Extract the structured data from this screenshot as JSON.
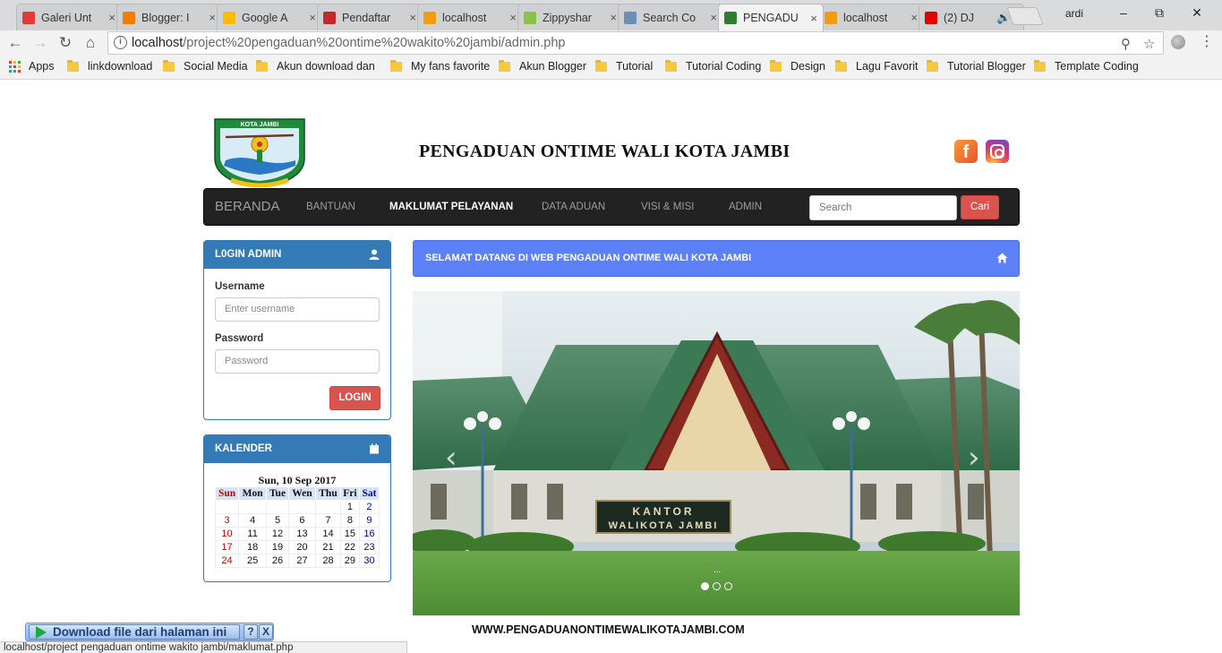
{
  "browser": {
    "tabs": [
      {
        "title": "Galeri Unt",
        "favicon_color": "#e53935"
      },
      {
        "title": "Blogger: I",
        "favicon_color": "#f57c00"
      },
      {
        "title": "Google A",
        "favicon_color": "#fbbc05"
      },
      {
        "title": "Pendaftar",
        "favicon_color": "#c62828"
      },
      {
        "title": "localhost",
        "favicon_color": "#f39c12"
      },
      {
        "title": "Zippyshar",
        "favicon_color": "#8bc34a"
      },
      {
        "title": "Search Co",
        "favicon_color": "#6d8fb5"
      },
      {
        "title": "PENGADU",
        "favicon_color": "#2e7d32"
      },
      {
        "title": "localhost",
        "favicon_color": "#f39c12"
      },
      {
        "title": "(2) DJ",
        "favicon_color": "#e00000"
      }
    ],
    "user": "ardi",
    "url_host": "localhost",
    "url_path": "/project%20pengaduan%20ontime%20wakito%20jambi/admin.php",
    "bookmarks": [
      "Apps",
      "linkdownload",
      "Social Media",
      "Akun download dan",
      "My fans favorite",
      "Akun Blogger",
      "Tutorial",
      "Tutorial Coding",
      "Design",
      "Lagu Favorit",
      "Tutorial Blogger",
      "Template Coding"
    ],
    "status_url": "localhost/project pengaduan ontime wakito jambi/maklumat.php"
  },
  "site": {
    "logo_text": "KOTA JAMBI",
    "title": "PENGADUAN ONTIME WALI KOTA JAMBI",
    "nav": {
      "brand": "BERANDA",
      "links": [
        "BANTUAN",
        "MAKLUMAT PELAYANAN",
        "DATA ADUAN",
        "VISI & MISI",
        "ADMIN"
      ],
      "active_index": 1,
      "search_placeholder": "Search",
      "search_button": "Cari"
    },
    "login": {
      "heading": "L0GIN ADMIN",
      "username_label": "Username",
      "username_placeholder": "Enter username",
      "password_label": "Password",
      "password_placeholder": "Password",
      "button": "LOGIN"
    },
    "calendar": {
      "heading": "KALENDER",
      "date": "Sun, 10 Sep 2017",
      "weekdays": [
        "Sun",
        "Mon",
        "Tue",
        "Wen",
        "Thu",
        "Fri",
        "Sat"
      ],
      "weeks": [
        [
          "",
          "",
          "",
          "",
          "",
          "1",
          "2"
        ],
        [
          "3",
          "4",
          "5",
          "6",
          "7",
          "8",
          "9"
        ],
        [
          "10",
          "11",
          "12",
          "13",
          "14",
          "15",
          "16"
        ],
        [
          "17",
          "18",
          "19",
          "20",
          "21",
          "22",
          "23"
        ],
        [
          "24",
          "25",
          "26",
          "27",
          "28",
          "29",
          "30"
        ]
      ]
    },
    "welcome": "SELAMAT DATANG DI WEB PENGADUAN ONTIME WALI KOTA JAMBI",
    "slide": {
      "sign_line1": "KANTOR",
      "sign_line2": "WALIKOTA JAMBI",
      "caption": "...",
      "slide_count": 3,
      "active_slide": 0
    },
    "footer_url": "WWW.PENGADUANONTIMEWALIKOTAJAMBI.COM"
  },
  "download_bar": {
    "label": "Download file dari halaman ini",
    "help": "?",
    "close": "X"
  },
  "colors": {
    "navbar": "#222222",
    "panel": "#337ab7",
    "welcome": "#5b80f7",
    "danger": "#d9534f"
  }
}
